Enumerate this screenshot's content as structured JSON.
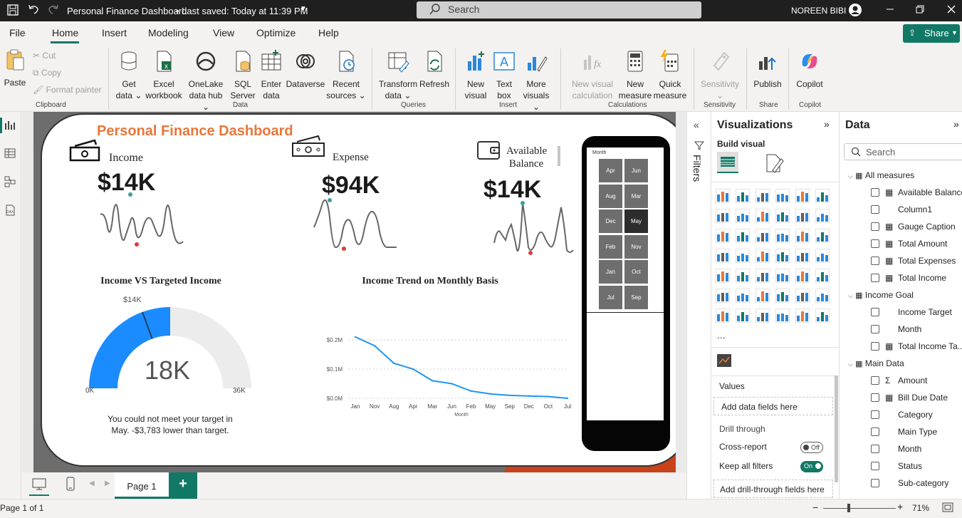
{
  "titlebar": {
    "title": "Personal Finance Dashboard",
    "saved": "• Last saved: Today at 11:39 PM",
    "search_placeholder": "Search",
    "user": "NOREEN BIBI"
  },
  "menu": {
    "items": [
      "File",
      "Home",
      "Insert",
      "Modeling",
      "View",
      "Optimize",
      "Help"
    ],
    "active": "Home",
    "share_label": "Share"
  },
  "ribbon": {
    "clipboard": {
      "paste": "Paste",
      "cut": "Cut",
      "copy": "Copy",
      "format_painter": "Format painter",
      "group": "Clipboard"
    },
    "data": {
      "get_data": [
        "Get",
        "data"
      ],
      "excel": [
        "Excel",
        "workbook"
      ],
      "onelake": [
        "OneLake",
        "data hub"
      ],
      "sql": [
        "SQL",
        "Server"
      ],
      "enter": [
        "Enter",
        "data"
      ],
      "dataverse": "Dataverse",
      "recent": [
        "Recent",
        "sources"
      ],
      "group": "Data"
    },
    "queries": {
      "transform": [
        "Transform",
        "data"
      ],
      "refresh": "Refresh",
      "group": "Queries"
    },
    "insert": {
      "new_visual": [
        "New",
        "visual"
      ],
      "text_box": [
        "Text",
        "box"
      ],
      "more_visuals": [
        "More",
        "visuals"
      ],
      "group": "Insert"
    },
    "calculations": {
      "new_visual_calc": [
        "New visual",
        "calculation"
      ],
      "new_measure": [
        "New",
        "measure"
      ],
      "quick_measure": [
        "Quick",
        "measure"
      ],
      "group": "Calculations"
    },
    "sensitivity": {
      "label": "Sensitivity",
      "group": "Sensitivity"
    },
    "share": {
      "publish": "Publish",
      "group": "Share"
    },
    "copilot": {
      "label": "Copilot",
      "group": "Copilot"
    }
  },
  "report": {
    "title": "Personal Finance Dashboard",
    "kpis": [
      {
        "label": "Income",
        "value": "$14K"
      },
      {
        "label": "Expense",
        "value": "$94K"
      },
      {
        "label": "Available Balance",
        "value": "$14K"
      }
    ],
    "gauge": {
      "title": "Income VS Targeted Income",
      "value_label": "18K",
      "target_label": "$14K",
      "min_label": "0K",
      "max_label": "36K",
      "value": 18,
      "target": 14,
      "min": 0,
      "max": 36,
      "caption_line1": "You could not meet your target in",
      "caption_line2": "May. -$3,783 lower than target."
    },
    "slicer": {
      "title": "Month",
      "months": [
        "Apr",
        "Jun",
        "Aug",
        "Mar",
        "Dec",
        "May",
        "Feb",
        "Nov",
        "Jan",
        "Oct",
        "Jul",
        "Sep"
      ],
      "selected": "May"
    }
  },
  "chart_data": [
    {
      "type": "line",
      "title": "Income Trend on Monthly Basis",
      "xlabel": "Month",
      "ylabel": "",
      "categories": [
        "Jan",
        "Nov",
        "Aug",
        "Apr",
        "Mar",
        "Jun",
        "Feb",
        "May",
        "Sep",
        "Dec",
        "Oct",
        "Jul"
      ],
      "values": [
        0.21,
        0.18,
        0.12,
        0.1,
        0.06,
        0.05,
        0.025,
        0.015,
        0.01,
        0.008,
        0.006,
        0.0
      ],
      "ylim": [
        0,
        0.2
      ],
      "yticks": [
        "$0.0M",
        "$0.1M",
        "$0.2M"
      ],
      "grid": true,
      "color": "#2196f3"
    }
  ],
  "filters": {
    "label": "Filters"
  },
  "visualizations": {
    "title": "Visualizations",
    "build_visual": "Build visual",
    "values": "Values",
    "add_data": "Add data fields here",
    "drill_through": "Drill through",
    "cross_report": "Cross-report",
    "cross_report_state": "Off",
    "keep_filters": "Keep all filters",
    "keep_filters_state": "On",
    "add_drill": "Add drill-through fields here",
    "more": "..."
  },
  "data_pane": {
    "title": "Data",
    "search_placeholder": "Search",
    "tables": [
      {
        "name": "All measures",
        "fields": [
          "Available Balance",
          "Column1",
          "Gauge Caption",
          "Total Amount",
          "Total Expenses",
          "Total Income"
        ]
      },
      {
        "name": "Income Goal",
        "fields": [
          "Income Target",
          "Month",
          "Total Income Ta..."
        ]
      },
      {
        "name": "Main Data",
        "fields": [
          "Amount",
          "Bill Due Date",
          "Category",
          "Main Type",
          "Month",
          "Status",
          "Sub-category"
        ]
      }
    ]
  },
  "pages": {
    "current": "Page 1",
    "add": "+"
  },
  "status": {
    "page_info": "Page 1 of 1",
    "zoom": "71%"
  },
  "colors": {
    "accent_orange": "#e8773a",
    "power_bi_green": "#117865",
    "gauge_blue": "#1a8cff",
    "dark_red": "#c8421b"
  }
}
